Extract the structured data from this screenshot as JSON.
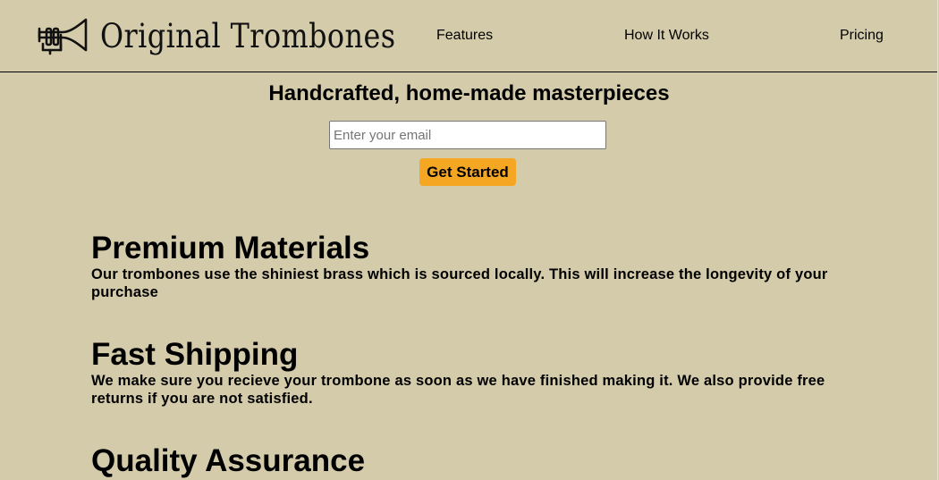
{
  "header": {
    "brand": "Original Trombones",
    "logo_icon": "trombone-icon",
    "nav": [
      {
        "label": "Features"
      },
      {
        "label": "How It Works"
      },
      {
        "label": "Pricing"
      }
    ]
  },
  "hero": {
    "title": "Handcrafted, home-made masterpieces",
    "email_placeholder": "Enter your email",
    "email_value": "",
    "cta_label": "Get Started",
    "cta_color": "#f5a623"
  },
  "features": [
    {
      "title": "Premium Materials",
      "text": "Our trombones use the shiniest brass which is sourced locally. This will increase the longevity of your purchase"
    },
    {
      "title": "Fast Shipping",
      "text": "We make sure you recieve your trombone as soon as we have finished making it. We also provide free returns if you are not satisfied."
    },
    {
      "title": "Quality Assurance",
      "text": ""
    }
  ],
  "colors": {
    "background": "#d4cbab",
    "accent": "#f5a623",
    "text": "#000000"
  }
}
